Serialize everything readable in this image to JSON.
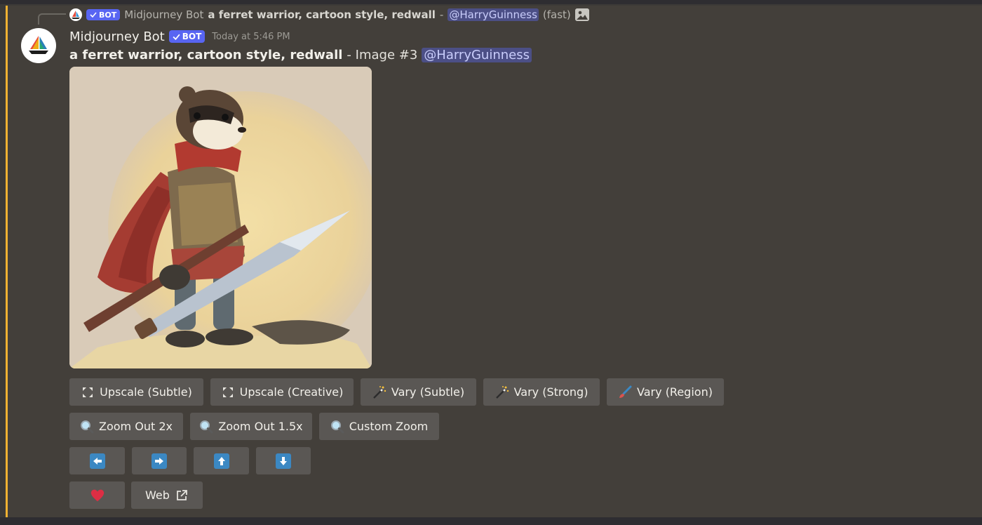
{
  "reply": {
    "author": "Midjourney Bot",
    "bot_label": "BOT",
    "prompt": "a ferret warrior, cartoon style, redwall",
    "separator": "-",
    "mention": "@HarryGuinness",
    "speed": "(fast)",
    "attachment_icon": "image-icon"
  },
  "message": {
    "author": "Midjourney Bot",
    "bot_label": "BOT",
    "timestamp": "Today at 5:46 PM",
    "prompt": "a ferret warrior, cartoon style, redwall",
    "suffix": "- Image #3",
    "mention": "@HarryGuinness",
    "accent_color": "#f0b232",
    "bot_tag_color": "#5865f2"
  },
  "buttons": {
    "row1": [
      {
        "label": "Upscale (Subtle)",
        "icon": "expand-icon"
      },
      {
        "label": "Upscale (Creative)",
        "icon": "expand-icon"
      },
      {
        "label": "Vary (Subtle)",
        "icon": "magic-wand-icon"
      },
      {
        "label": "Vary (Strong)",
        "icon": "magic-wand-icon"
      },
      {
        "label": "Vary (Region)",
        "icon": "paintbrush-icon"
      }
    ],
    "row2": [
      {
        "label": "Zoom Out 2x",
        "icon": "magnifier-icon"
      },
      {
        "label": "Zoom Out 1.5x",
        "icon": "magnifier-icon"
      },
      {
        "label": "Custom Zoom",
        "icon": "magnifier-icon"
      }
    ],
    "row3": [
      {
        "icon": "arrow-left-icon"
      },
      {
        "icon": "arrow-right-icon"
      },
      {
        "icon": "arrow-up-icon"
      },
      {
        "icon": "arrow-down-icon"
      }
    ],
    "row4": [
      {
        "icon": "heart-icon"
      },
      {
        "label": "Web",
        "icon": "external-link-icon"
      }
    ]
  }
}
